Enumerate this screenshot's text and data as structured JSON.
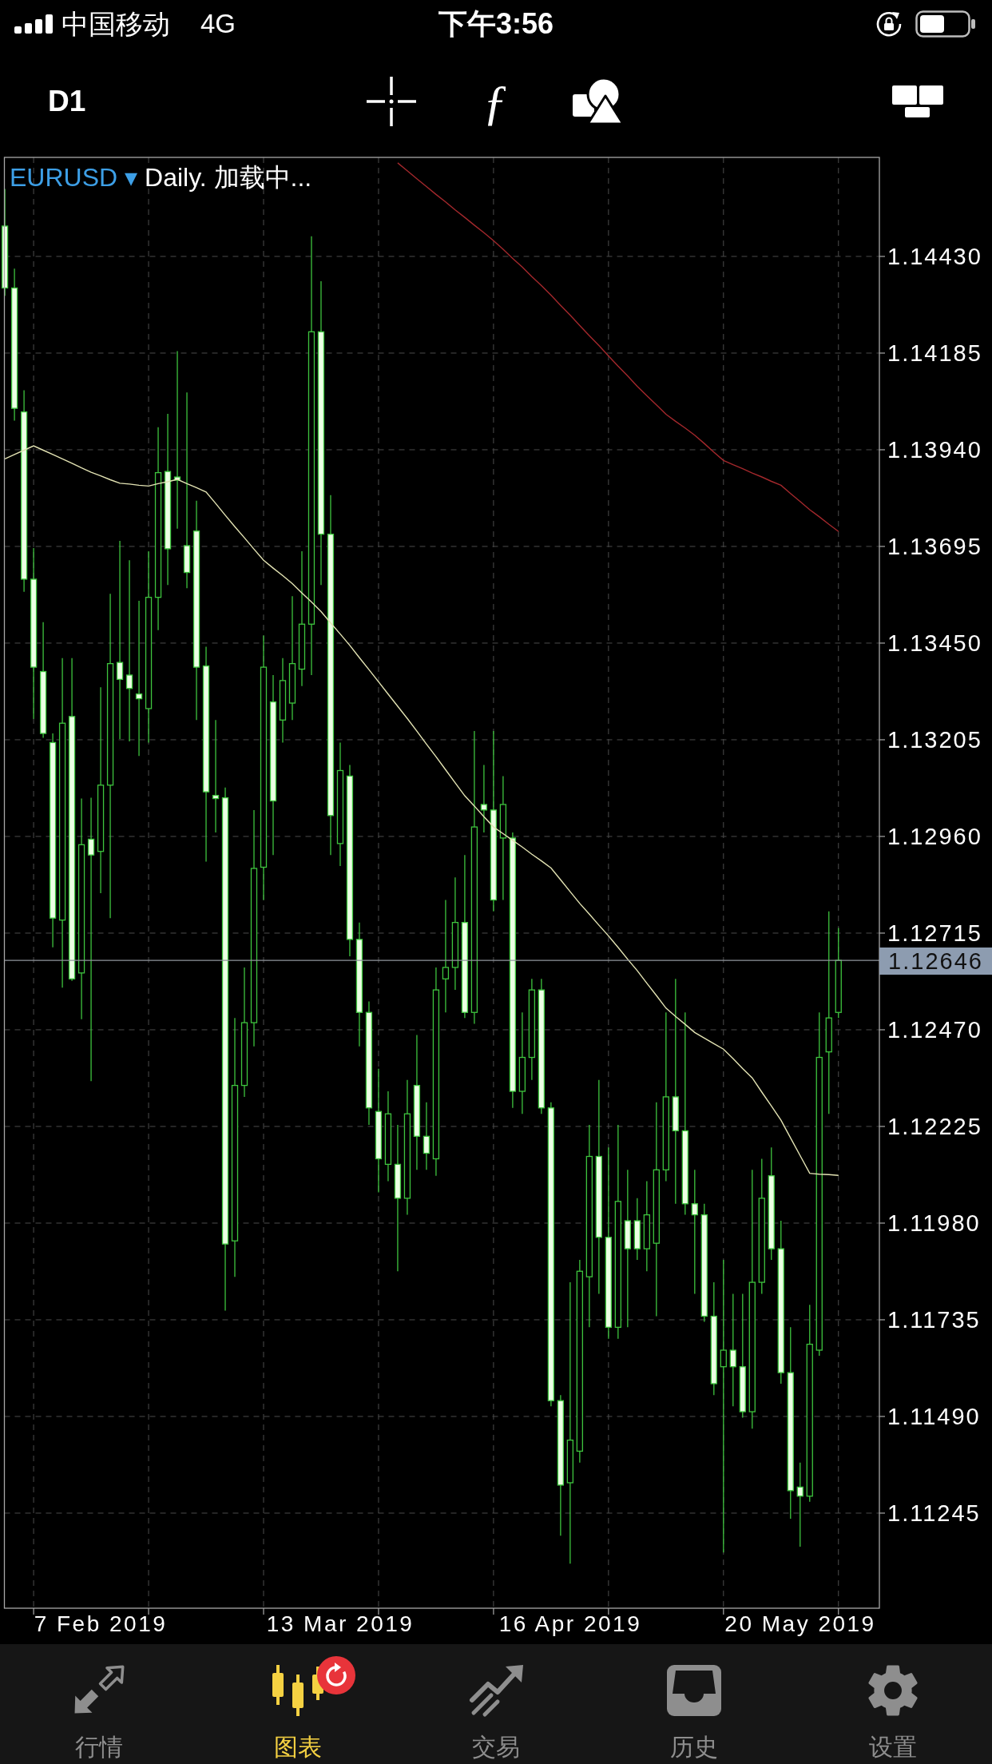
{
  "status_bar": {
    "carrier": "中国移动",
    "network": "4G",
    "time": "下午3:56"
  },
  "toolbar": {
    "timeframe": "D1",
    "function_glyph": "ƒ"
  },
  "chart": {
    "symbol": "EURUSD",
    "symbol_caret": "▾",
    "caption": "Daily. 加载中...",
    "chart_data": {
      "type": "candlestick",
      "categories": [
        null,
        null,
        null,
        null,
        null,
        null,
        null,
        null,
        null,
        null,
        "7 Feb 2019",
        null,
        null,
        null,
        null,
        null,
        null,
        null,
        null,
        null,
        null,
        null,
        null,
        null,
        null,
        null,
        null,
        null,
        null,
        null,
        null,
        null,
        null,
        null,
        null,
        "13 Mar 2019",
        null,
        null,
        null,
        null,
        null,
        null,
        null,
        null,
        null,
        null,
        null,
        null,
        null,
        null,
        null,
        null,
        null,
        null,
        null,
        null,
        null,
        null,
        null,
        "16 Apr 2019",
        null,
        null,
        null,
        null,
        null,
        null,
        null,
        null,
        null,
        null,
        null,
        null,
        null,
        null,
        null,
        null,
        null,
        null,
        null,
        null,
        null,
        null,
        null,
        "20 May 2019",
        null,
        null,
        null,
        null
      ],
      "ylim": [
        1.11004,
        1.14681
      ],
      "grid": true,
      "yticks": [
        {
          "value": 1.1443,
          "label": "1.14430"
        },
        {
          "value": 1.14185,
          "label": "1.14185"
        },
        {
          "value": 1.1394,
          "label": "1.13940"
        },
        {
          "value": 1.13695,
          "label": "1.13695"
        },
        {
          "value": 1.1345,
          "label": "1.13450"
        },
        {
          "value": 1.13205,
          "label": "1.13205"
        },
        {
          "value": 1.1296,
          "label": "1.12960"
        },
        {
          "value": 1.12715,
          "label": "1.12715"
        },
        {
          "value": 1.1247,
          "label": "1.12470"
        },
        {
          "value": 1.12225,
          "label": "1.12225"
        },
        {
          "value": 1.1198,
          "label": "1.11980"
        },
        {
          "value": 1.11735,
          "label": "1.11735"
        },
        {
          "value": 1.1149,
          "label": "1.11490"
        },
        {
          "value": 1.11245,
          "label": "1.11245"
        }
      ],
      "ohlc": [
        [
          1.14507,
          1.14601,
          1.1433,
          1.1435
        ],
        [
          1.1435,
          1.14399,
          1.14014,
          1.14045
        ],
        [
          1.14036,
          1.14091,
          1.1358,
          1.13612
        ],
        [
          1.13612,
          1.13691,
          1.13258,
          1.13389
        ],
        [
          1.13378,
          1.13503,
          1.1321,
          1.13221
        ],
        [
          1.13198,
          1.13221,
          1.12679,
          1.12753
        ],
        [
          1.12748,
          1.13412,
          1.12577,
          1.13247
        ],
        [
          1.13264,
          1.13412,
          1.12594,
          1.12599
        ],
        [
          1.12614,
          1.13056,
          1.12497,
          1.12939
        ],
        [
          1.12953,
          1.13058,
          1.1234,
          1.12913
        ],
        [
          1.12922,
          1.13338,
          1.12816,
          1.1309
        ],
        [
          1.1309,
          1.13575,
          1.12753,
          1.13398
        ],
        [
          1.13401,
          1.13709,
          1.13207,
          1.13358
        ],
        [
          1.13369,
          1.1366,
          1.13201,
          1.13335
        ],
        [
          1.13321,
          1.13557,
          1.13164,
          1.13309
        ],
        [
          1.13284,
          1.13683,
          1.13198,
          1.13566
        ],
        [
          1.13566,
          1.13997,
          1.13483,
          1.13882
        ],
        [
          1.13885,
          1.14031,
          1.13597,
          1.13689
        ],
        [
          1.13871,
          1.1419,
          1.1374,
          1.13863
        ],
        [
          1.13697,
          1.14085,
          1.13589,
          1.13629
        ],
        [
          1.13734,
          1.13811,
          1.13255,
          1.13389
        ],
        [
          1.13392,
          1.13441,
          1.12896,
          1.13073
        ],
        [
          1.13064,
          1.13255,
          1.1297,
          1.13056
        ],
        [
          1.13058,
          1.13084,
          1.11758,
          1.11927
        ],
        [
          1.11935,
          1.125,
          1.11844,
          1.12329
        ],
        [
          1.12329,
          1.12628,
          1.123,
          1.12488
        ],
        [
          1.12488,
          1.13027,
          1.12428,
          1.12879
        ],
        [
          1.12882,
          1.13469,
          1.12799,
          1.13389
        ],
        [
          1.13301,
          1.13369,
          1.12913,
          1.1305
        ],
        [
          1.13255,
          1.13412,
          1.13198,
          1.13355
        ],
        [
          1.13298,
          1.13569,
          1.13255,
          1.13398
        ],
        [
          1.13384,
          1.13683,
          1.13341,
          1.13498
        ],
        [
          1.13498,
          1.14481,
          1.13369,
          1.14239
        ],
        [
          1.14239,
          1.14367,
          1.13597,
          1.13726
        ],
        [
          1.13726,
          1.13825,
          1.12913,
          1.13013
        ],
        [
          1.12942,
          1.13198,
          1.12885,
          1.13127
        ],
        [
          1.13113,
          1.13141,
          1.12656,
          1.12699
        ],
        [
          1.12699,
          1.12742,
          1.12428,
          1.12514
        ],
        [
          1.12514,
          1.12542,
          1.12229,
          1.12272
        ],
        [
          1.12263,
          1.12371,
          1.12058,
          1.12143
        ],
        [
          1.12129,
          1.12314,
          1.12086,
          1.12257
        ],
        [
          1.12129,
          1.12229,
          1.11858,
          1.12043
        ],
        [
          1.12043,
          1.12343,
          1.12001,
          1.12257
        ],
        [
          1.12329,
          1.12457,
          1.12115,
          1.122
        ],
        [
          1.122,
          1.12286,
          1.12115,
          1.12157
        ],
        [
          1.12143,
          1.12628,
          1.121,
          1.12571
        ],
        [
          1.12599,
          1.12799,
          1.12514,
          1.12628
        ],
        [
          1.12628,
          1.12856,
          1.12571,
          1.12742
        ],
        [
          1.12742,
          1.12913,
          1.125,
          1.12514
        ],
        [
          1.12514,
          1.13227,
          1.12485,
          1.12984
        ],
        [
          1.13041,
          1.13141,
          1.1297,
          1.13027
        ],
        [
          1.13027,
          1.13227,
          1.1277,
          1.12799
        ],
        [
          1.12956,
          1.13113,
          1.12799,
          1.13041
        ],
        [
          1.12956,
          1.1297,
          1.12272,
          1.12314
        ],
        [
          1.12314,
          1.12514,
          1.12257,
          1.124
        ],
        [
          1.124,
          1.12599,
          1.12343,
          1.12571
        ],
        [
          1.12571,
          1.12599,
          1.12257,
          1.12272
        ],
        [
          1.12272,
          1.12286,
          1.11516,
          1.1153
        ],
        [
          1.1153,
          1.11544,
          1.11188,
          1.11316
        ],
        [
          1.11322,
          1.1183,
          1.11117,
          1.1143
        ],
        [
          1.11402,
          1.11887,
          1.11373,
          1.11858
        ],
        [
          1.11844,
          1.12229,
          1.11716,
          1.12149
        ],
        [
          1.12149,
          1.12343,
          1.11801,
          1.11944
        ],
        [
          1.11944,
          1.12172,
          1.11687,
          1.11716
        ],
        [
          1.11716,
          1.12229,
          1.11687,
          1.12035
        ],
        [
          1.11986,
          1.12115,
          1.11716,
          1.11915
        ],
        [
          1.11986,
          1.12043,
          1.11887,
          1.11915
        ],
        [
          1.11915,
          1.12086,
          1.11858,
          1.12001
        ],
        [
          1.11929,
          1.12286,
          1.11744,
          1.12115
        ],
        [
          1.12115,
          1.12514,
          1.12086,
          1.123
        ],
        [
          1.123,
          1.12599,
          1.12029,
          1.12214
        ],
        [
          1.12214,
          1.12514,
          1.12001,
          1.12029
        ],
        [
          1.12029,
          1.12115,
          1.11801,
          1.12001
        ],
        [
          1.12001,
          1.12029,
          1.1173,
          1.11744
        ],
        [
          1.11744,
          1.1183,
          1.11544,
          1.11573
        ],
        [
          1.11616,
          1.11887,
          1.11145,
          1.11658
        ],
        [
          1.11658,
          1.11801,
          1.11516,
          1.11616
        ],
        [
          1.11616,
          1.11801,
          1.11487,
          1.11502
        ],
        [
          1.11502,
          1.12115,
          1.11459,
          1.1183
        ],
        [
          1.1183,
          1.12143,
          1.11801,
          1.12043
        ],
        [
          1.121,
          1.12172,
          1.11887,
          1.11915
        ],
        [
          1.11915,
          1.11986,
          1.11573,
          1.11601
        ],
        [
          1.11601,
          1.11716,
          1.11231,
          1.11302
        ],
        [
          1.11311,
          1.11373,
          1.1116,
          1.11288
        ],
        [
          1.11288,
          1.11773,
          1.11274,
          1.11673
        ],
        [
          1.11658,
          1.12514,
          1.11644,
          1.124
        ],
        [
          1.12414,
          1.1277,
          1.12257,
          1.125
        ],
        [
          1.12514,
          1.12728,
          1.125,
          1.12646
        ]
      ],
      "series": [
        {
          "type": "line",
          "color": "#e4e4b4",
          "values": [
            1.13917,
            1.13928,
            1.13939,
            1.1395,
            1.13939,
            1.13928,
            1.13917,
            1.13906,
            1.13894,
            1.13883,
            1.13874,
            1.13864,
            1.13855,
            1.13853,
            1.1385,
            1.13848,
            1.13854,
            1.13859,
            1.13865,
            1.13854,
            1.13844,
            1.13833,
            1.13804,
            1.13774,
            1.13745,
            1.13717,
            1.13688,
            1.1366,
            1.1364,
            1.13621,
            1.13601,
            1.13577,
            1.13554,
            1.1353,
            1.13501,
            1.13473,
            1.13444,
            1.13413,
            1.13383,
            1.13352,
            1.13321,
            1.1329,
            1.13259,
            1.13227,
            1.13194,
            1.13162,
            1.13129,
            1.13096,
            1.13063,
            1.13037,
            1.1301,
            1.12984,
            1.12967,
            1.1295,
            1.12933,
            1.12915,
            1.12898,
            1.1288,
            1.1285,
            1.1282,
            1.1279,
            1.12763,
            1.12735,
            1.12708,
            1.12679,
            1.12649,
            1.1262,
            1.12588,
            1.12557,
            1.12525,
            1.12504,
            1.12484,
            1.12463,
            1.12449,
            1.12435,
            1.12421,
            1.12397,
            1.12372,
            1.12348,
            1.12312,
            1.12277,
            1.12241,
            1.12196,
            1.12151,
            1.12106,
            1.12104,
            1.12103,
            1.12101
          ]
        },
        {
          "type": "line",
          "color": "#a3282c",
          "values": [
            null,
            null,
            null,
            null,
            null,
            null,
            null,
            null,
            null,
            null,
            null,
            null,
            null,
            null,
            null,
            null,
            null,
            null,
            null,
            null,
            null,
            null,
            null,
            null,
            null,
            null,
            null,
            null,
            null,
            null,
            null,
            null,
            null,
            null,
            null,
            null,
            null,
            null,
            null,
            null,
            null,
            1.14667,
            1.14647,
            1.14627,
            1.14607,
            1.14587,
            1.14568,
            1.14548,
            1.14529,
            1.14509,
            1.1449,
            1.1447,
            1.14448,
            1.14425,
            1.14403,
            1.14379,
            1.14356,
            1.14332,
            1.14306,
            1.14281,
            1.14255,
            1.14229,
            1.14204,
            1.14178,
            1.14152,
            1.14127,
            1.14101,
            1.14077,
            1.14054,
            1.1403,
            1.14012,
            1.13995,
            1.13977,
            1.13956,
            1.13934,
            1.13913,
            1.13902,
            1.13892,
            1.13881,
            1.13871,
            1.1386,
            1.1385,
            1.13829,
            1.13809,
            1.13788,
            1.1377,
            1.13751,
            1.13733
          ]
        }
      ],
      "ref_lines": [
        {
          "axis": "y",
          "value": 1.12646,
          "label": "1.12646"
        }
      ]
    }
  },
  "tabs": [
    {
      "label": "行情",
      "selected": false,
      "refresh_badge": false
    },
    {
      "label": "图表",
      "selected": true,
      "refresh_badge": true
    },
    {
      "label": "交易",
      "selected": false,
      "refresh_badge": false
    },
    {
      "label": "历史",
      "selected": false,
      "refresh_badge": false
    },
    {
      "label": "设置",
      "selected": false,
      "refresh_badge": false
    }
  ]
}
